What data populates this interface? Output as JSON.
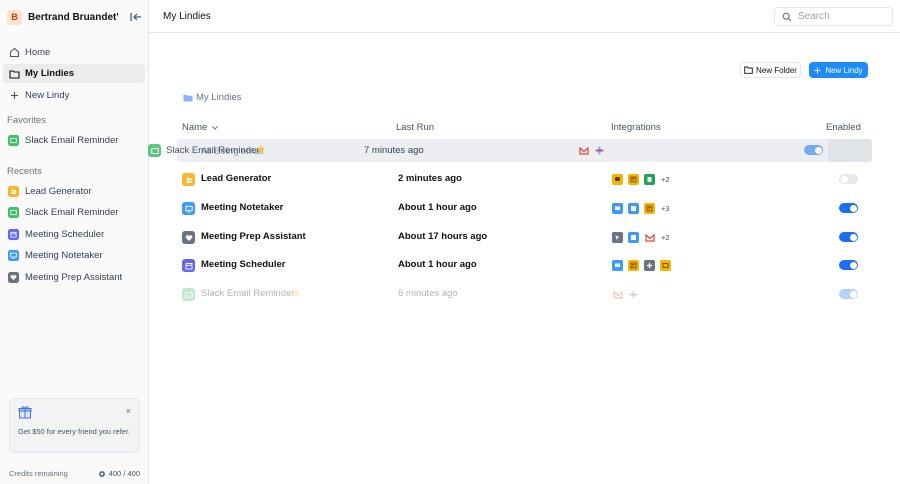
{
  "workspace": {
    "avatar_letter": "B",
    "name": "Bertrand Bruandet's..."
  },
  "nav": {
    "home": "Home",
    "my_lindies": "My Lindies",
    "new_lindy": "New Lindy"
  },
  "favorites": {
    "title": "Favorites",
    "items": [
      {
        "label": "Slack Email Reminder",
        "color": "#3fbf6a"
      }
    ]
  },
  "recents": {
    "title": "Recents",
    "items": [
      {
        "label": "Lead Generator",
        "color": "#f5b82e"
      },
      {
        "label": "Slack Email Reminder",
        "color": "#3fbf6a"
      },
      {
        "label": "Meeting Scheduler",
        "color": "#6366f1"
      },
      {
        "label": "Meeting Notetaker",
        "color": "#3b9cf2"
      },
      {
        "label": "Meeting Prep Assistant",
        "color": "#6b7280"
      }
    ]
  },
  "referral": {
    "text": "Get $50 for every friend you refer.",
    "close": "×"
  },
  "credits": {
    "label": "Credits remaining",
    "value": "400 / 400"
  },
  "header": {
    "title": "My Lindies",
    "search_placeholder": "Search"
  },
  "toolbar": {
    "new_folder": "New Folder",
    "new_lindy": "New Lindy"
  },
  "breadcrumb": "My Lindies",
  "columns": {
    "name": "Name",
    "last_run": "Last Run",
    "integrations": "Integrations",
    "enabled": "Enabled"
  },
  "dragging": {
    "name": "Slack Email Reminder",
    "underlay": "All Being email",
    "last_run": "7 minutes ago",
    "enabled": true
  },
  "rows": [
    {
      "name": "Lead Generator",
      "last_run": "2 minutes ago",
      "more": "+2",
      "enabled": false,
      "color": "#f5b82e"
    },
    {
      "name": "Meeting Notetaker",
      "last_run": "About 1 hour ago",
      "more": "+3",
      "enabled": true,
      "color": "#3b9cf2"
    },
    {
      "name": "Meeting Prep Assistant",
      "last_run": "About 17 hours ago",
      "more": "+2",
      "enabled": true,
      "color": "#6b7280"
    },
    {
      "name": "Meeting Scheduler",
      "last_run": "About 1 hour ago",
      "more": "",
      "enabled": true,
      "color": "#6366f1"
    },
    {
      "name": "Slack Email Reminder",
      "last_run": "6 minutes ago",
      "more": "",
      "enabled": true,
      "color": "#3fbf6a"
    }
  ],
  "accent_color": "#1d8cf8"
}
